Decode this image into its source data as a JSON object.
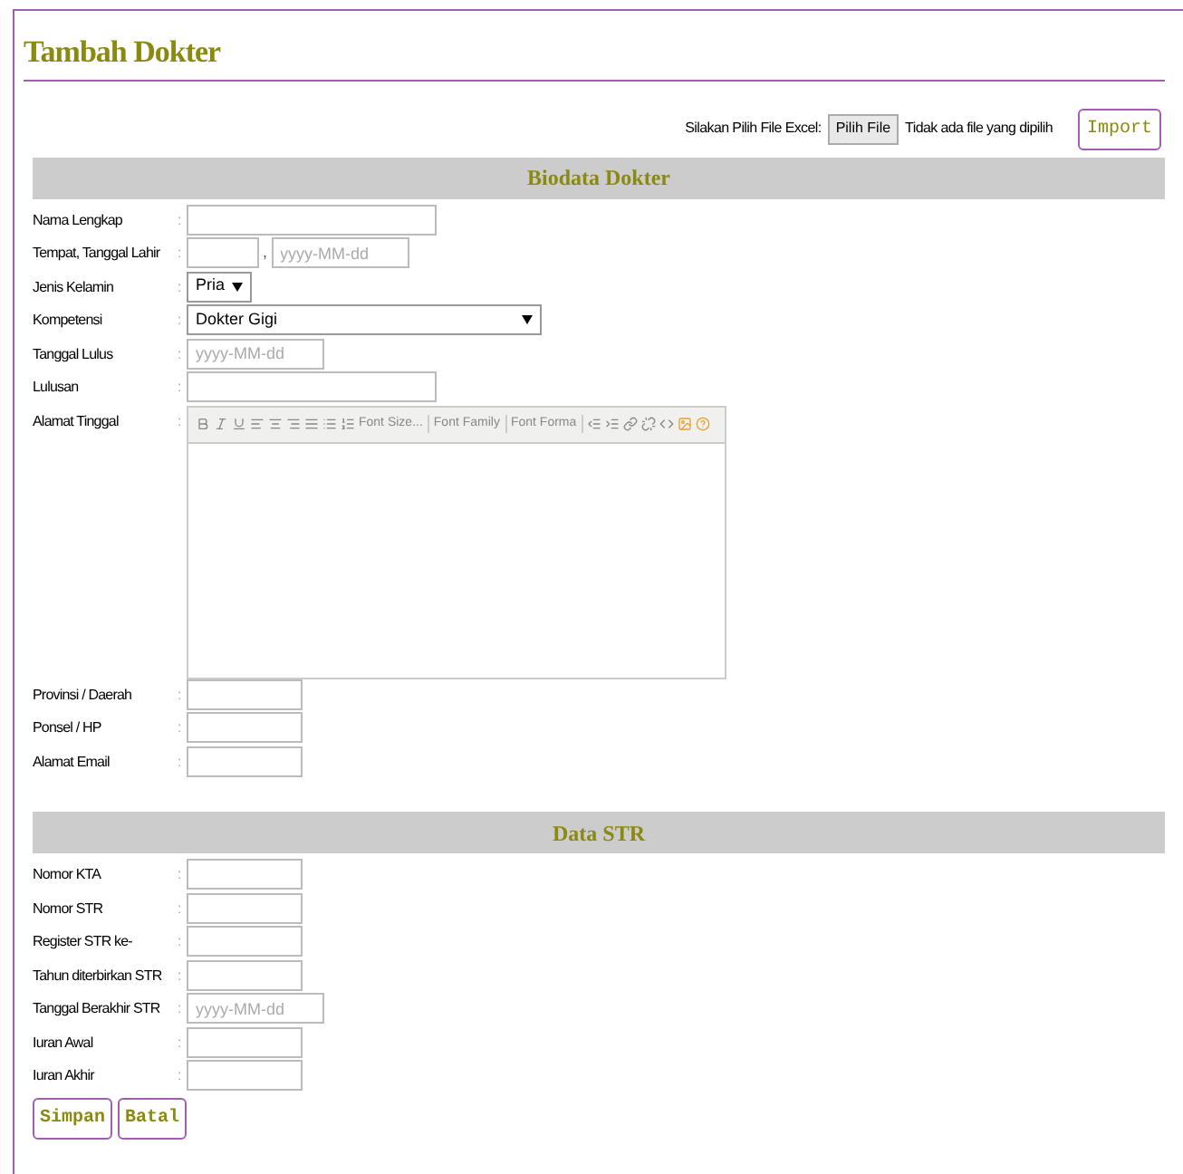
{
  "title": "Tambah Dokter",
  "import": {
    "label": "Silakan Pilih File Excel:",
    "file_button": "Pilih File",
    "file_status": "Tidak ada file yang dipilih",
    "button": "Import"
  },
  "sections": [
    {
      "title": "Biodata Dokter",
      "fields": [
        {
          "kind": "text-long",
          "label": "Nama Lengkap",
          "colon": ":"
        },
        {
          "kind": "place-date",
          "label": "Tempat, Tanggal Lahir",
          "colon": ":",
          "comma": ",",
          "placeholder": "yyyy-MM-dd"
        },
        {
          "kind": "select-short",
          "label": "Jenis Kelamin",
          "colon": ":",
          "value": "Pria"
        },
        {
          "kind": "select-wide",
          "label": "Kompetensi",
          "colon": ":",
          "value": "Dokter Gigi"
        },
        {
          "kind": "date",
          "label": "Tanggal Lulus",
          "colon": ":",
          "placeholder": "yyyy-MM-dd"
        },
        {
          "kind": "text-long",
          "label": "Lulusan",
          "colon": ":"
        },
        {
          "kind": "editor",
          "label": "Alamat Tinggal",
          "colon": ":",
          "dropdowns": [
            "Font Size...",
            "Font Family",
            "Font Forma"
          ]
        },
        {
          "kind": "text-short",
          "label": "Provinsi / Daerah",
          "colon": ":"
        },
        {
          "kind": "text-short",
          "label": "Ponsel / HP",
          "colon": ":"
        },
        {
          "kind": "text-short",
          "label": "Alamat Email",
          "colon": ":"
        }
      ]
    },
    {
      "title": "Data STR",
      "fields": [
        {
          "kind": "text-short",
          "label": "Nomor KTA",
          "colon": ":"
        },
        {
          "kind": "text-short",
          "label": "Nomor STR",
          "colon": ":"
        },
        {
          "kind": "text-short",
          "label": "Register STR ke-",
          "colon": ":"
        },
        {
          "kind": "text-short",
          "label": "Tahun diterbirkan STR",
          "colon": ":"
        },
        {
          "kind": "date",
          "label": "Tanggal Berakhir STR",
          "colon": ":",
          "placeholder": "yyyy-MM-dd"
        },
        {
          "kind": "text-short",
          "label": "Iuran Awal",
          "colon": ":"
        },
        {
          "kind": "text-short",
          "label": "Iuran Akhir",
          "colon": ":"
        }
      ]
    }
  ],
  "buttons": [
    "Simpan",
    "Batal"
  ]
}
